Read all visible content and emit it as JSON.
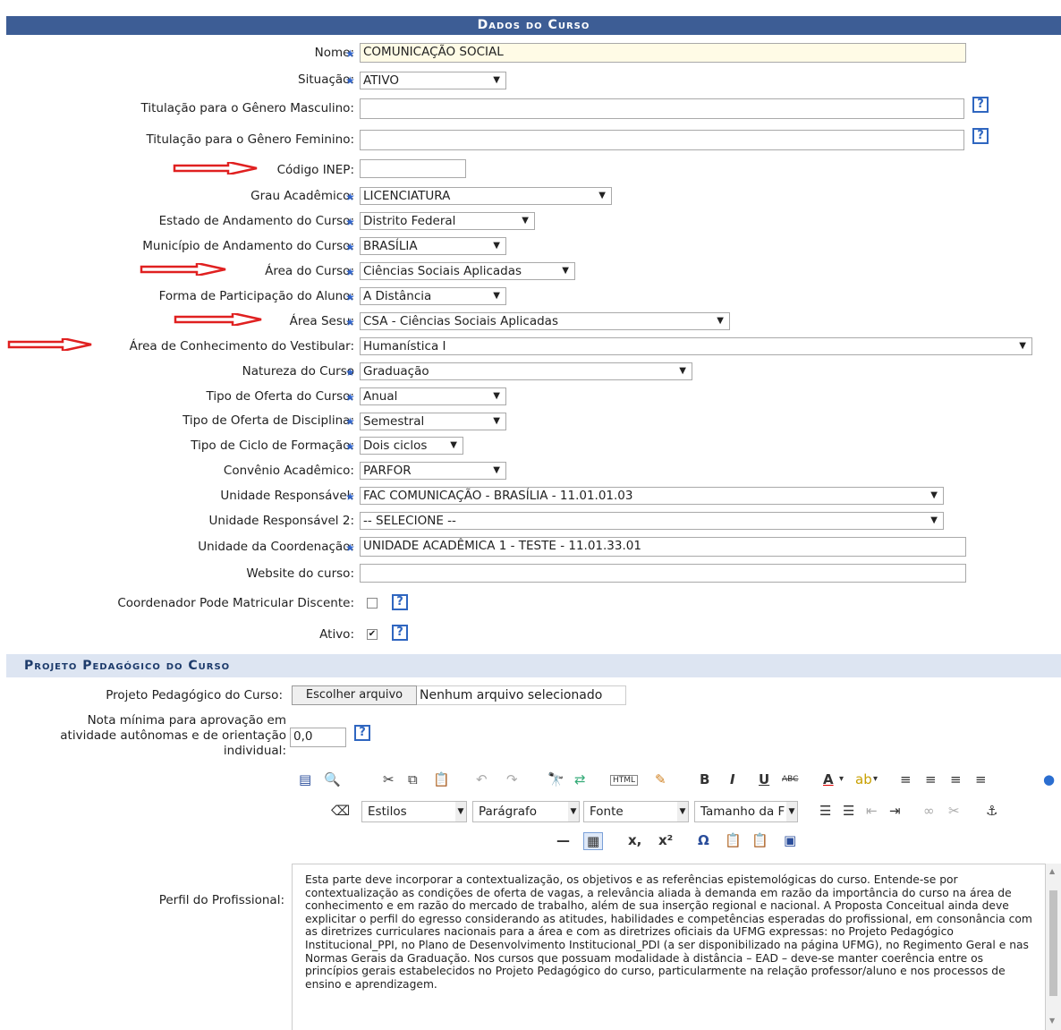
{
  "header": {
    "title": "Dados do Curso"
  },
  "form": {
    "nome": {
      "label": "Nome:",
      "value": "COMUNICAÇÃO SOCIAL"
    },
    "situacao": {
      "label": "Situação:",
      "value": "ATIVO"
    },
    "tit_masc": {
      "label": "Titulação para o Gênero Masculino:",
      "value": ""
    },
    "tit_fem": {
      "label": "Titulação para o Gênero Feminino:",
      "value": ""
    },
    "inep": {
      "label": "Código INEP:",
      "value": ""
    },
    "grau": {
      "label": "Grau Acadêmico:",
      "value": "LICENCIATURA"
    },
    "estado": {
      "label": "Estado de Andamento do Curso:",
      "value": "Distrito Federal"
    },
    "municipio": {
      "label": "Município de Andamento do Curso:",
      "value": "BRASÍLIA"
    },
    "area": {
      "label": "Área do Curso:",
      "value": "Ciências Sociais Aplicadas"
    },
    "forma": {
      "label": "Forma de Participação do Aluno:",
      "value": "A Distância"
    },
    "sesu": {
      "label": "Área Sesu:",
      "value": "CSA - Ciências Sociais Aplicadas"
    },
    "vestibular": {
      "label": "Área de Conhecimento do Vestibular:",
      "value": "Humanística I"
    },
    "natureza": {
      "label": "Natureza do Curso",
      "value": "Graduação"
    },
    "tipo_oferta": {
      "label": "Tipo de Oferta do Curso:",
      "value": "Anual"
    },
    "tipo_disc": {
      "label": "Tipo de Oferta de Disciplina:",
      "value": "Semestral"
    },
    "ciclo": {
      "label": "Tipo de Ciclo de Formação:",
      "value": "Dois ciclos"
    },
    "convenio": {
      "label": "Convênio Acadêmico:",
      "value": "PARFOR"
    },
    "unidade": {
      "label": "Unidade Responsável:",
      "value": "FAC COMUNICAÇÃO - BRASÍLIA - 11.01.01.03"
    },
    "unidade2": {
      "label": "Unidade Responsável 2:",
      "value": "-- SELECIONE --"
    },
    "coord": {
      "label": "Unidade da Coordenação:",
      "value": "UNIDADE ACADÊMICA 1 - TESTE - 11.01.33.01"
    },
    "website": {
      "label": "Website do curso:",
      "value": ""
    },
    "coord_matric": {
      "label": "Coordenador Pode Matricular Discente:",
      "checked": false
    },
    "ativo": {
      "label": "Ativo:",
      "checked": true
    }
  },
  "projeto": {
    "section_title": "Projeto Pedagógico do Curso",
    "file_label": "Projeto Pedagógico do Curso:",
    "file_button": "Escolher arquivo",
    "file_status": "Nenhum arquivo selecionado",
    "nota_label_1": "Nota mínima para aprovação em",
    "nota_label_2": "atividade autônomas e de orientação",
    "nota_label_3": "individual:",
    "nota_value": "0,0",
    "perfil_label": "Perfil do Profissional:",
    "perfil_text": "Esta parte deve incorporar a contextualização, os objetivos e as referências epistemológicas do curso. Entende-se por contextualização as condições de oferta de vagas, a relevância aliada à demanda em razão da importância do curso na área de conhecimento e em razão do mercado de trabalho, além de sua inserção regional e nacional. A Proposta Conceitual ainda deve explicitar o perfil do egresso considerando as atitudes, habilidades e competências esperadas do profissional, em consonância com as diretrizes curriculares nacionais para a área e com as diretrizes oficiais da UFMG expressas: no Projeto Pedagógico Institucional_PPI, no Plano de Desenvolvimento Institucional_PDI (a ser disponibilizado na página UFMG), no Regimento Geral e nas Normas Gerais da Graduação. Nos cursos que possuam modalidade à distância – EAD – deve-se manter coerência entre os princípios gerais estabelecidos no Projeto Pedagógico do curso, particularmente na relação professor/aluno e nos processos de ensino e aprendizagem."
  },
  "editor_toolbar": {
    "estilos": "Estilos",
    "paragrafo": "Parágrafo",
    "fonte": "Fonte",
    "tamanho": "Tamanho da F",
    "bold": "B",
    "italic": "I",
    "underline": "U",
    "strike": "ABC",
    "html": "HTML",
    "sub": "x,",
    "sup": "x²",
    "omega": "Ω"
  },
  "colors": {
    "header_bg": "#3d5d95",
    "section_bg": "#dde5f2",
    "arrow": "#e02020",
    "required_star": "#3366cc"
  }
}
